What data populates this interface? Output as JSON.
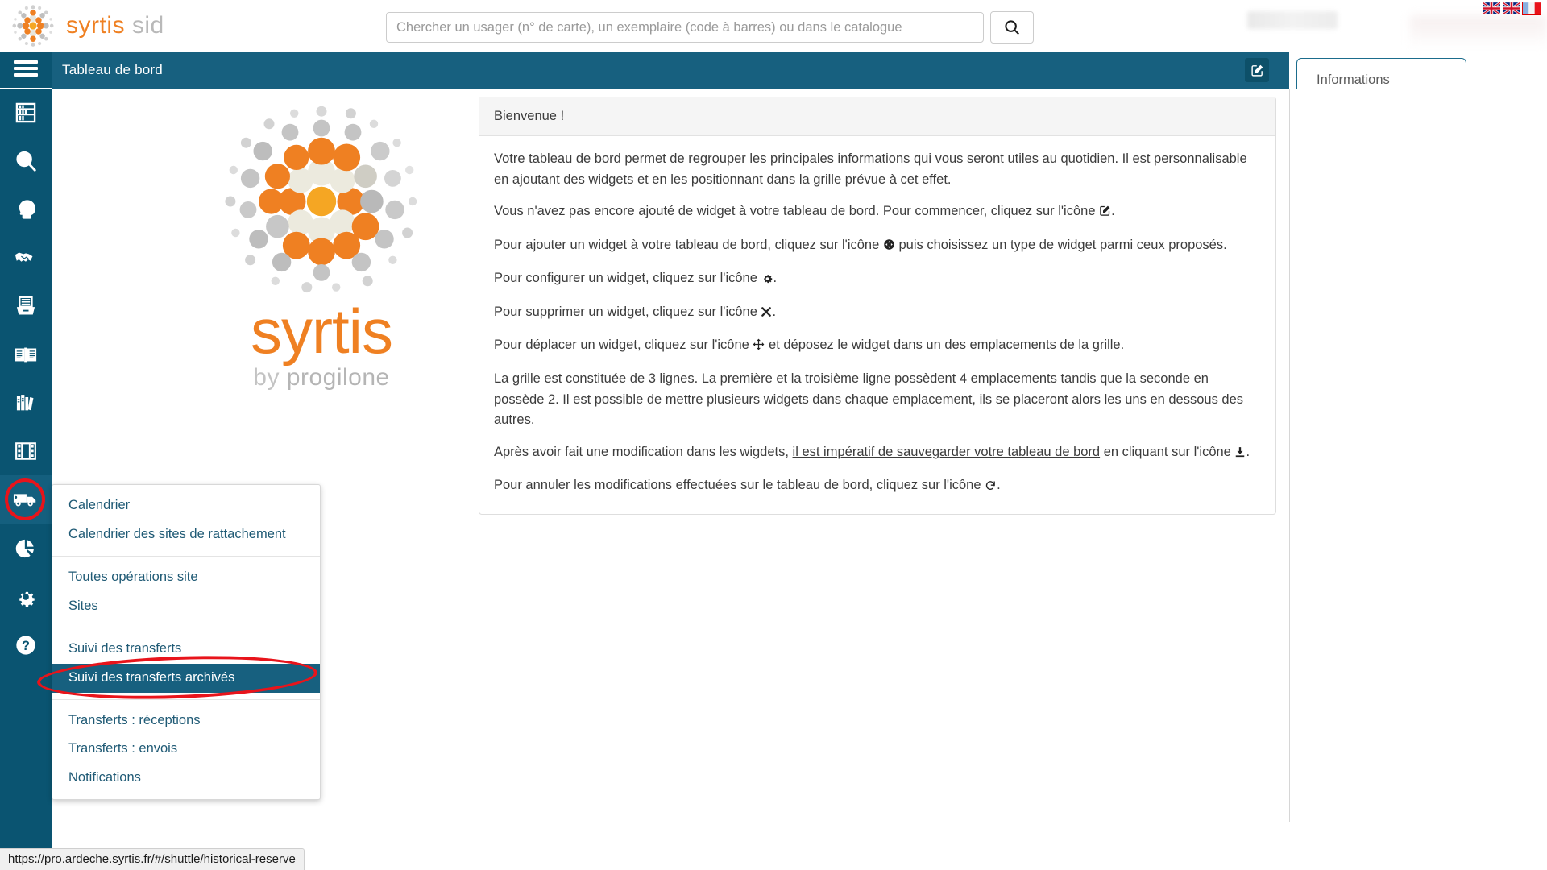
{
  "brand": {
    "name_primary": "syrtis",
    "name_secondary": "sid"
  },
  "search": {
    "placeholder": "Chercher un usager (n° de carte), un exemplaire (code à barres) ou dans le catalogue",
    "value": "",
    "button_icon": "search-icon"
  },
  "languages": [
    {
      "name": "english-flag",
      "active": false
    },
    {
      "name": "english-flag-alt",
      "active": false
    },
    {
      "name": "french-flag",
      "active": true
    }
  ],
  "sidebar": {
    "toggle_icon": "hamburger-menu-icon",
    "items": [
      {
        "icon": "bookshelf-icon",
        "name": "sidebar-item-catalogue",
        "active": false
      },
      {
        "icon": "search-icon",
        "name": "sidebar-item-recherche",
        "active": false
      },
      {
        "icon": "user-head-icon",
        "name": "sidebar-item-usagers",
        "active": false
      },
      {
        "icon": "handshake-icon",
        "name": "sidebar-item-pret",
        "active": false
      },
      {
        "icon": "inbox-tray-icon",
        "name": "sidebar-item-acquisitions",
        "active": false
      },
      {
        "icon": "open-book-icon",
        "name": "sidebar-item-periodiques",
        "active": false
      },
      {
        "icon": "books-row-icon",
        "name": "sidebar-item-collections",
        "active": false
      },
      {
        "icon": "film-strip-icon",
        "name": "sidebar-item-multimedia",
        "active": false
      },
      {
        "icon": "truck-icon",
        "name": "sidebar-item-navette",
        "active": true
      },
      {
        "icon": "pie-chart-icon",
        "name": "sidebar-item-statistiques",
        "active": false
      },
      {
        "icon": "gear-icon",
        "name": "sidebar-item-parametres",
        "active": false
      },
      {
        "icon": "question-mark-icon",
        "name": "sidebar-item-aide",
        "active": false
      }
    ]
  },
  "header": {
    "title": "Tableau de bord",
    "edit_icon": "edit-square-icon"
  },
  "tabs": [
    {
      "label": "Informations",
      "active": true
    }
  ],
  "logo_panel": {
    "word": "syrtis",
    "by": "by",
    "company": "progilone"
  },
  "welcome_card": {
    "title": "Bienvenue !",
    "paragraphs": [
      {
        "id": "p1",
        "text": "Votre tableau de bord permet de regrouper les principales informations qui vous seront utiles au quotidien. Il est personnalisable en ajoutant des widgets et en les positionnant dans la grille prévue à cet effet."
      },
      {
        "id": "p2a",
        "text": "Vous n'avez pas encore ajouté de widget à votre tableau de bord. Pour commencer, cliquez sur l'icône",
        "icon": "edit-square-icon",
        "tail": "."
      },
      {
        "id": "p3a",
        "text": "Pour ajouter un widget à votre tableau de bord, cliquez sur l'icône",
        "icon": "plus-circle-icon",
        "tail": "puis choisissez un type de widget parmi ceux proposés."
      },
      {
        "id": "p4a",
        "text": "Pour configurer un widget, cliquez sur l'icône",
        "icon": "gear-icon",
        "tail": "."
      },
      {
        "id": "p5a",
        "text": "Pour supprimer un widget, cliquez sur l'icône",
        "icon": "close-x-icon",
        "tail": "."
      },
      {
        "id": "p6a",
        "text": "Pour déplacer un widget, cliquez sur l'icône",
        "icon": "move-arrows-icon",
        "tail": "et déposez le widget dans un des emplacements de la grille."
      },
      {
        "id": "p7",
        "text": "La grille est constituée de 3 lignes. La première et la troisième ligne possèdent 4 emplacements tandis que la seconde en possède 2. Il est possible de mettre plusieurs widgets dans chaque emplacement, ils se placeront alors les uns en dessous des autres."
      },
      {
        "id": "p8a",
        "text": "Après avoir fait une modification dans les wigdets,",
        "underlined": "il est impératif de sauvegarder votre tableau de bord",
        "mid": "en cliquant sur l'icône",
        "icon": "download-save-icon",
        "tail": "."
      },
      {
        "id": "p9a",
        "text": "Pour annuler les modifications effectuées sur le tableau de bord, cliquez sur l'icône",
        "icon": "undo-icon",
        "tail": "."
      }
    ]
  },
  "dropdown_menu": {
    "groups": [
      {
        "items": [
          {
            "label": "Calendrier",
            "selected": false
          },
          {
            "label": "Calendrier des sites de rattachement",
            "selected": false
          }
        ]
      },
      {
        "items": [
          {
            "label": "Toutes opérations site",
            "selected": false
          },
          {
            "label": "Sites",
            "selected": false
          }
        ]
      },
      {
        "items": [
          {
            "label": "Suivi des transferts",
            "selected": false
          },
          {
            "label": "Suivi des transferts archivés",
            "selected": true
          }
        ]
      },
      {
        "items": [
          {
            "label": "Transferts : réceptions",
            "selected": false
          },
          {
            "label": "Transferts : envois",
            "selected": false
          },
          {
            "label": "Notifications",
            "selected": false
          }
        ]
      }
    ]
  },
  "status_bar": {
    "url": "https://pro.ardeche.syrtis.fr/#/shuttle/historical-reserve"
  },
  "colors": {
    "sidebar": "#0a5471",
    "header": "#17607f",
    "accent_orange": "#ef8022",
    "annotation_red": "#e8141b",
    "menu_link": "#1f5a75"
  }
}
